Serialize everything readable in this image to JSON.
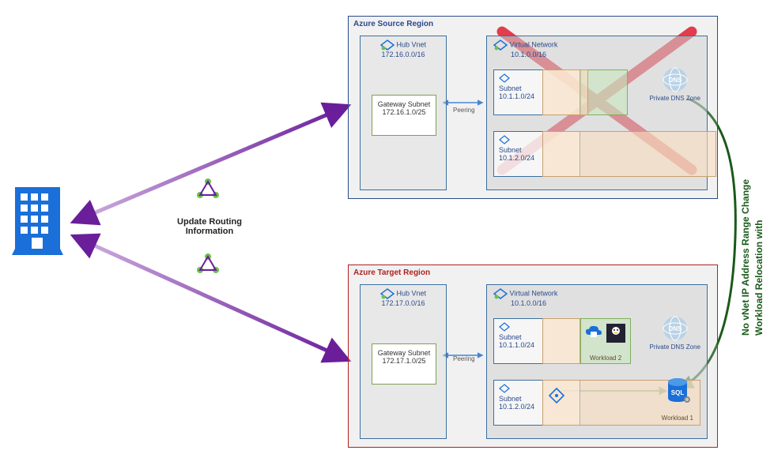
{
  "left": {
    "building_label": "",
    "routing_label": "Update Routing Information"
  },
  "source": {
    "title": "Azure Source Region",
    "hub": {
      "name": "Hub Vnet",
      "cidr": "172.16.0.0/16"
    },
    "gateway": {
      "name": "Gateway Subnet",
      "cidr": "172.16.1.0/25"
    },
    "peering": "Peering",
    "vnet": {
      "name": "Virtual Network",
      "cidr": "10.1.0.0/16"
    },
    "subnet1": {
      "name": "Subnet",
      "cidr": "10.1.1.0/24"
    },
    "subnet2": {
      "name": "Subnet",
      "cidr": "10.1.2.0/24"
    },
    "dns": "Private DNS Zone"
  },
  "target": {
    "title": "Azure Target Region",
    "hub": {
      "name": "Hub Vnet",
      "cidr": "172.17.0.0/16"
    },
    "gateway": {
      "name": "Gateway Subnet",
      "cidr": "172.17.1.0/25"
    },
    "peering": "Peering",
    "vnet": {
      "name": "Virtual Network",
      "cidr": "10.1.0.0/16"
    },
    "subnet1": {
      "name": "Subnet",
      "cidr": "10.1.1.0/24"
    },
    "subnet2": {
      "name": "Subnet",
      "cidr": "10.1.2.0/24"
    },
    "dns": "Private DNS Zone",
    "workload1": "Workload 1",
    "workload2": "Workload 2"
  },
  "right": {
    "line1": "Workload Relocation with",
    "line2": "No vNet IP Address Range Change"
  },
  "colors": {
    "source_border": "#2a4a8a",
    "target_border": "#b02020",
    "purple": "#6a1e9a",
    "green": "#1a7a1a",
    "blue": "#1a6fd8"
  }
}
